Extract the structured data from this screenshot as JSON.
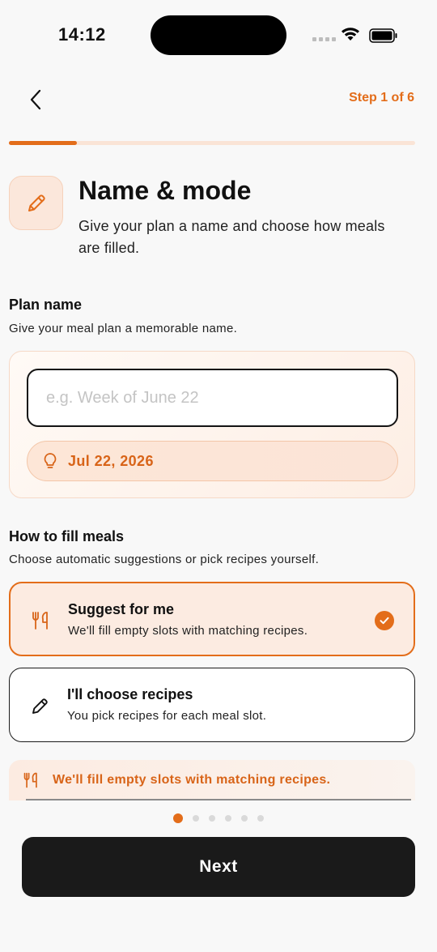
{
  "status_bar": {
    "time": "14:12"
  },
  "header": {
    "step_label": "Step 1 of 6",
    "progress_fraction": 0.1667
  },
  "title_section": {
    "title": "Name & mode",
    "subtitle": "Give your plan a name and choose how meals are filled."
  },
  "plan_name": {
    "heading": "Plan name",
    "description": "Give your meal plan a memorable name.",
    "input_value": "",
    "input_placeholder": "e.g. Week of June 22",
    "suggestion_chip": "Jul 22, 2026"
  },
  "fill_mode": {
    "heading": "How to fill meals",
    "description": "Choose automatic suggestions or pick recipes yourself.",
    "options": [
      {
        "title": "Suggest for me",
        "description": "We'll fill empty slots with matching recipes.",
        "selected": true,
        "icon": "fork-knife-icon"
      },
      {
        "title": "I'll choose recipes",
        "description": "You pick recipes for each meal slot.",
        "selected": false,
        "icon": "pencil-icon"
      }
    ],
    "hint": "We'll fill empty slots with matching recipes."
  },
  "pagination": {
    "total": 6,
    "active_index": 0
  },
  "footer": {
    "next_label": "Next"
  },
  "colors": {
    "accent": "#e36d1a",
    "accent_light": "#fcebe1",
    "dark_button": "#1a1a1a"
  }
}
